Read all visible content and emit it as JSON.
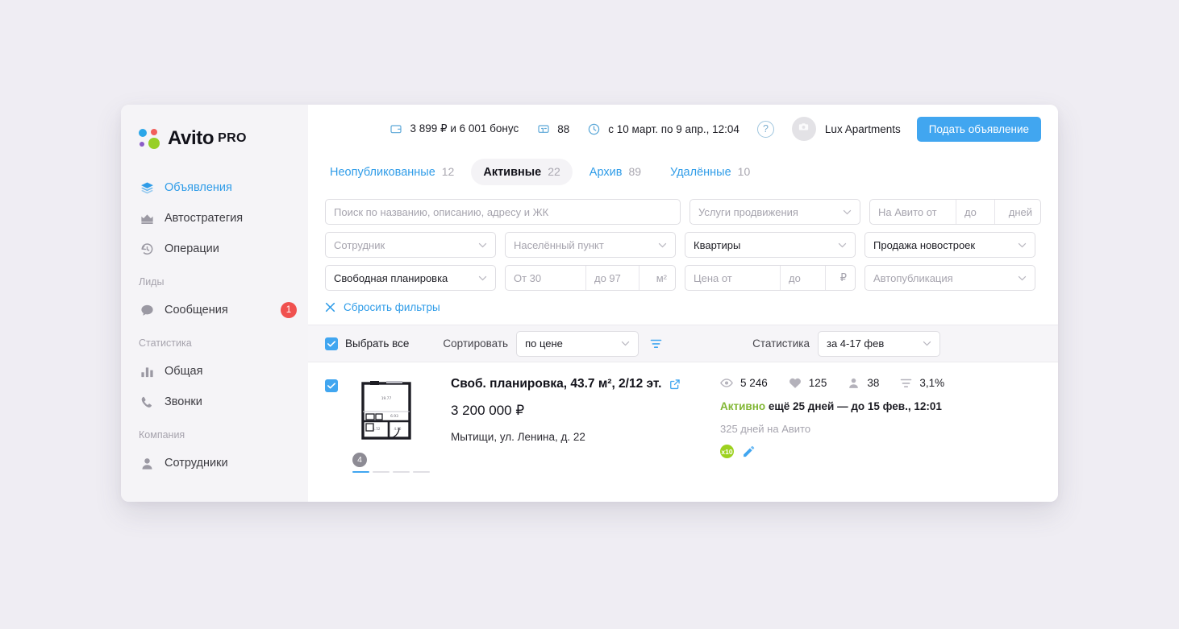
{
  "brand": {
    "name": "Avito",
    "suffix": "PRO",
    "colors": {
      "blue": "#2ba6e8",
      "red": "#f25f5c",
      "purple": "#8b5cc7",
      "green": "#97cf26"
    }
  },
  "sidebar": {
    "items": [
      {
        "label": "Объявления",
        "icon": "layers-icon",
        "active": true
      },
      {
        "label": "Автостратегия",
        "icon": "crown-icon",
        "active": false
      },
      {
        "label": "Операции",
        "icon": "history-icon",
        "active": false
      }
    ],
    "group_leads": "Лиды",
    "messages": {
      "label": "Сообщения",
      "icon": "chat-icon",
      "badge": "1"
    },
    "group_stats": "Статистика",
    "stats_items": [
      {
        "label": "Общая",
        "icon": "bar-chart-icon"
      },
      {
        "label": "Звонки",
        "icon": "phone-icon"
      }
    ],
    "group_company": "Компания",
    "company_items": [
      {
        "label": "Сотрудники",
        "icon": "user-icon"
      }
    ]
  },
  "topbar": {
    "balance": "3 899 ₽ и 6 001 бонус",
    "balance_icon": "wallet-icon",
    "coins": "88",
    "coins_icon": "coin-icon",
    "period": "с 10 март. по 9 апр., 12:04",
    "period_icon": "clock-icon",
    "help_icon": "question-icon",
    "help_label": "?",
    "avatar_icon": "camera-icon",
    "user_name": "Lux Apartments",
    "primary_button": "Подать объявление",
    "primary_color": "#41a6f0"
  },
  "tabs": [
    {
      "label": "Неопубликованные",
      "count": "12",
      "active": false
    },
    {
      "label": "Активные",
      "count": "22",
      "active": true
    },
    {
      "label": "Архив",
      "count": "89",
      "active": false
    },
    {
      "label": "Удалённые",
      "count": "10",
      "active": false
    }
  ],
  "filters": {
    "search_placeholder": "Поиск по названию, описанию, адресу и ЖК",
    "promo_placeholder": "Услуги продвижения",
    "avito_from": "На Авито от",
    "avito_to": "до",
    "avito_unit": "дней",
    "employee_placeholder": "Сотрудник",
    "locality_placeholder": "Населённый пункт",
    "category_value": "Квартиры",
    "deal_value": "Продажа новостроек",
    "layout_value": "Свободная планировка",
    "area_from": "От 30",
    "area_to": "до 97",
    "area_unit": "м²",
    "price_from": "Цена от",
    "price_to": "до",
    "price_unit": "₽",
    "autopublish_placeholder": "Автопубликация",
    "reset_label": "Сбросить фильтры",
    "reset_icon": "close-x-icon"
  },
  "toolbar": {
    "select_all": "Выбрать все",
    "sort_label": "Сортировать",
    "sort_value": "по цене",
    "filter_icon": "funnel-icon",
    "stats_label": "Статистика",
    "stats_value": "за 4-17 фев"
  },
  "listing": {
    "checked": true,
    "thumbnail_type": "floor-plan",
    "photo_count": "4",
    "title": "Своб. планировка, 43.7 м², 2/12 эт.",
    "external_link_icon": "external-link-icon",
    "price": "3 200 000 ₽",
    "address": "Мытищи, ул. Ленина, д. 22",
    "stats": [
      {
        "icon": "eye-icon",
        "value": "5 246"
      },
      {
        "icon": "heart-icon",
        "value": "125"
      },
      {
        "icon": "contact-icon",
        "value": "38"
      },
      {
        "icon": "funnel-icon",
        "value": "3,1%"
      }
    ],
    "status_active": "Активно",
    "status_rest": " ещё 25 дней — до 15 фев., 12:01",
    "days_on_avito": "325 дней на Авито",
    "badge_multiplier": "x10",
    "badge_pencil_icon": "highlight-icon",
    "status_color": "#82b735"
  }
}
